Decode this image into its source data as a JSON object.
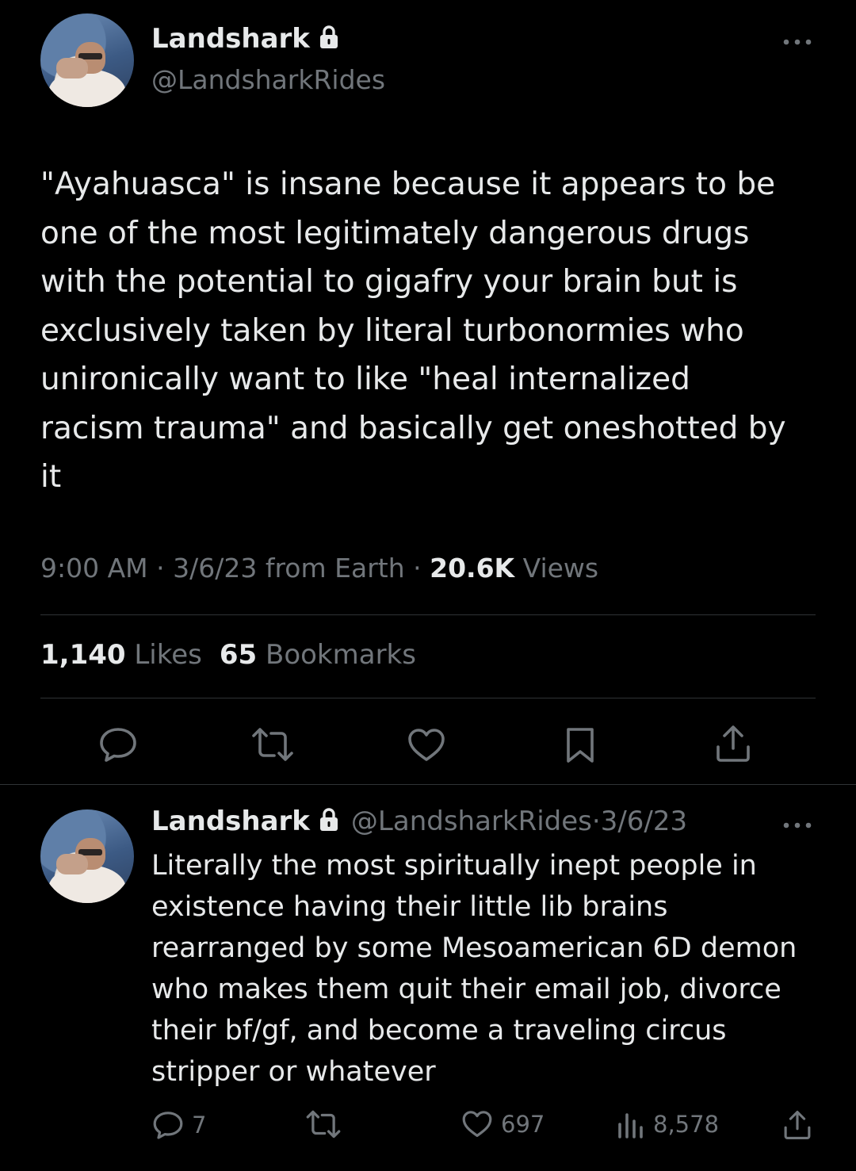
{
  "main_tweet": {
    "author_name": "Landshark",
    "author_handle": "@LandsharkRides",
    "text_lines": [
      "\"Ayahuasca\" is insane because it appears to be",
      "one of the most legitimately dangerous drugs",
      "with the potential to gigafry your brain but is",
      "exclusively taken by literal turbonormies who",
      "unironically want to like \"heal internalized",
      "racism trauma\" and basically get oneshotted by",
      "it"
    ],
    "time": "9:00 AM",
    "sep1": " · ",
    "date": "3/6/23",
    "source": " from Earth",
    "sep2": " · ",
    "views_count": "20.6K",
    "views_label": " Views",
    "likes_count": "1,140",
    "likes_label": " Likes",
    "bookmarks_count": "65",
    "bookmarks_label": " Bookmarks",
    "icons": [
      "lock-icon",
      "more-icon",
      "reply-icon",
      "retweet-icon",
      "like-icon",
      "bookmark-icon",
      "share-icon"
    ]
  },
  "reply_tweet": {
    "author_name": "Landshark",
    "author_handle": "@LandsharkRides",
    "sep": "·",
    "date": "3/6/23",
    "text_lines": [
      "Literally the most spiritually inept people in",
      "existence having their little lib brains",
      "rearranged by some Mesoamerican 6D demon",
      "who makes them quit their email job, divorce",
      "their bf/gf, and become a traveling circus",
      "stripper or whatever"
    ],
    "reply_count": "7",
    "like_count": "697",
    "views_count": "8,578"
  },
  "colors": {
    "background": "#000000",
    "primary_text": "#e7e9ea",
    "secondary_text": "#71767b",
    "divider": "#2f3336"
  }
}
